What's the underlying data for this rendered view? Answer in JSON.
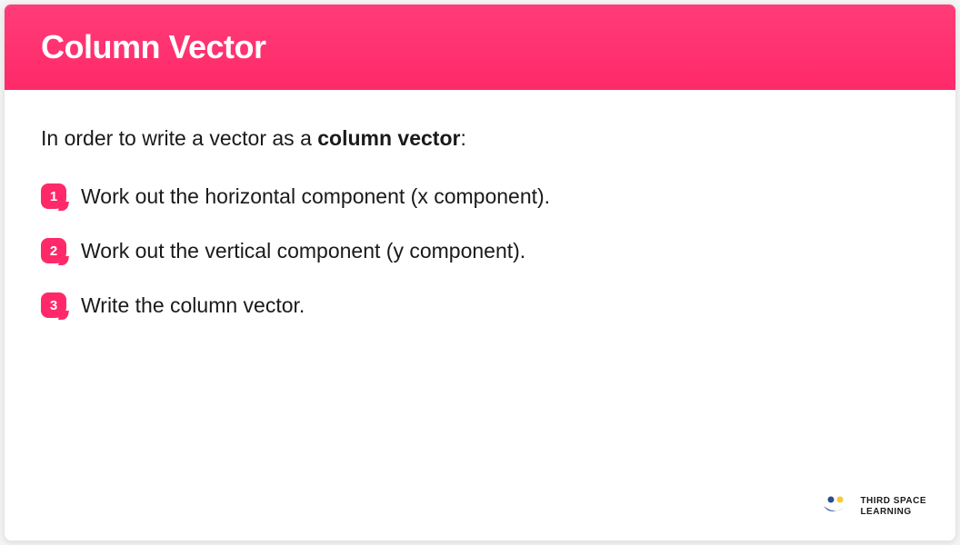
{
  "header": {
    "title": "Column Vector"
  },
  "intro": {
    "prefix": "In order to write a vector as a ",
    "bold": "column vector",
    "suffix": ":"
  },
  "steps": [
    {
      "number": "1",
      "text": "Work out the horizontal component (x component)."
    },
    {
      "number": "2",
      "text": "Work out the vertical component (y component)."
    },
    {
      "number": "3",
      "text": "Write the column vector."
    }
  ],
  "logo": {
    "line1": "THIRD SPACE",
    "line2": "LEARNING"
  },
  "colors": {
    "accent": "#ff2969",
    "text": "#1a1a1a"
  }
}
